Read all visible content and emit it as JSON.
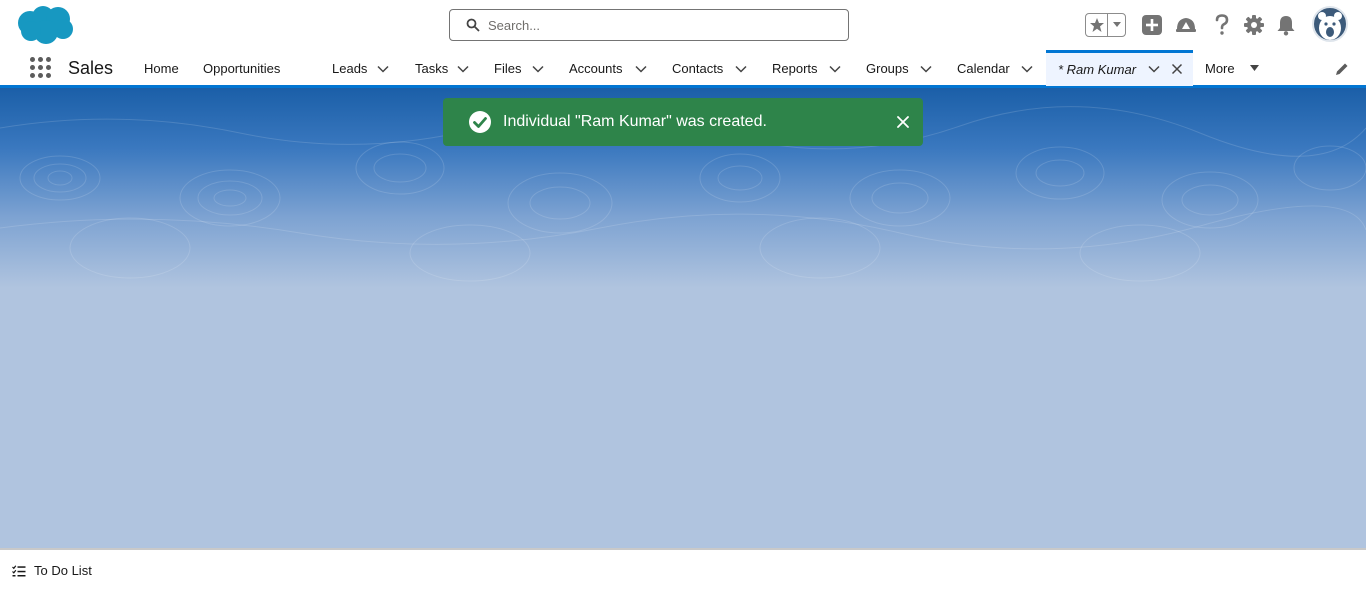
{
  "header": {
    "logo_icon": "salesforce-cloud-icon",
    "search_placeholder": "Search...",
    "icons": [
      "favorites-star-icon",
      "favorites-dropdown-icon",
      "global-actions-plus-icon",
      "trailhead-guidance-icon",
      "help-question-icon",
      "setup-gear-icon",
      "notifications-bell-icon",
      "user-avatar"
    ]
  },
  "nav": {
    "app_name": "Sales",
    "items": [
      {
        "label": "Home",
        "has_menu": false
      },
      {
        "label": "Opportunities",
        "has_menu": true
      },
      {
        "label": "Leads",
        "has_menu": true
      },
      {
        "label": "Tasks",
        "has_menu": true
      },
      {
        "label": "Files",
        "has_menu": true
      },
      {
        "label": "Accounts",
        "has_menu": true
      },
      {
        "label": "Contacts",
        "has_menu": true
      },
      {
        "label": "Reports",
        "has_menu": true
      },
      {
        "label": "Groups",
        "has_menu": true
      },
      {
        "label": "Calendar",
        "has_menu": true
      }
    ],
    "active_tab": {
      "label": "* Ram Kumar"
    },
    "more_label": "More"
  },
  "toast": {
    "message": "Individual \"Ram Kumar\" was created.",
    "status": "success",
    "color": "#2e844a"
  },
  "footer": {
    "todo_label": "To Do List"
  },
  "colors": {
    "brand_blue": "#0176d3",
    "background": "#b0c4df"
  }
}
